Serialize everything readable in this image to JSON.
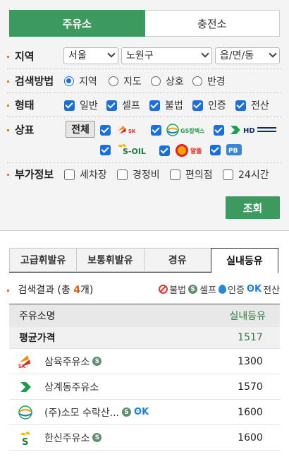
{
  "station_type_tabs": {
    "gas": "주유소",
    "ev": "충전소"
  },
  "region": {
    "label": "지역",
    "city": "서울",
    "district": "노원구",
    "town": "읍/면/동"
  },
  "search_method": {
    "label": "검색방법",
    "options": [
      "지역",
      "지도",
      "상호",
      "반경"
    ],
    "selected": "지역"
  },
  "form": {
    "label": "형태",
    "options": [
      {
        "label": "일반",
        "checked": true
      },
      {
        "label": "셀프",
        "checked": true
      },
      {
        "label": "불법",
        "checked": true
      },
      {
        "label": "인증",
        "checked": true
      },
      {
        "label": "전산",
        "checked": true
      }
    ]
  },
  "brand": {
    "label": "상표",
    "all_button": "전체",
    "items": [
      {
        "name": "SK에너지",
        "text": "SK",
        "checked": true,
        "color": "#e2231a"
      },
      {
        "name": "GS칼텍스",
        "text": "GS칼텍스",
        "checked": true,
        "color": "#1a9e4f"
      },
      {
        "name": "HD현대오일뱅크",
        "text": "HD",
        "checked": true,
        "color": "#0a2d6e"
      },
      {
        "name": "S-OIL",
        "text": "S-OIL",
        "checked": true,
        "color": "#1c7a3c"
      },
      {
        "name": "알뜰",
        "text": "알뜰",
        "checked": true,
        "color": "#e2231a"
      },
      {
        "name": "PB",
        "text": "PB",
        "checked": true,
        "color": "#3b86d4"
      }
    ]
  },
  "extra_info": {
    "label": "부가정보",
    "options": [
      {
        "label": "세차장",
        "checked": false
      },
      {
        "label": "경정비",
        "checked": false
      },
      {
        "label": "편의점",
        "checked": false
      },
      {
        "label": "24시간",
        "checked": false
      }
    ]
  },
  "search_button": "조회",
  "fuel_tabs": [
    "고급휘발유",
    "보통휘발유",
    "경유",
    "실내등유"
  ],
  "active_fuel_tab": "실내등유",
  "results": {
    "title_prefix": "검색결과 (총 ",
    "count": "4",
    "title_suffix": "개)",
    "legend": {
      "illegal": "불법",
      "self": "셀프",
      "certified": "인증",
      "computerized": "전산"
    },
    "columns": {
      "name": "주유소명",
      "price": "실내등유"
    },
    "average": {
      "label": "평균가격",
      "price": "1517"
    },
    "stations": [
      {
        "name": "삼육주유소",
        "price": "1300",
        "brand_icon": "sk-logo-icon",
        "self": true,
        "computerized": false
      },
      {
        "name": "상계동주유소",
        "price": "1570",
        "brand_icon": "hd-logo-icon",
        "self": false,
        "computerized": false
      },
      {
        "name": "(주)소모 수락산...",
        "price": "1600",
        "brand_icon": "gs-logo-icon",
        "self": true,
        "computerized": true
      },
      {
        "name": "한신주유소",
        "price": "1600",
        "brand_icon": "soil-logo-icon",
        "self": true,
        "computerized": false
      }
    ]
  },
  "colors": {
    "accent_green": "#3c9a5f",
    "checkbox_blue": "#1a6fe0",
    "bullet_orange": "#e07800",
    "count_orange": "#e65c00"
  }
}
